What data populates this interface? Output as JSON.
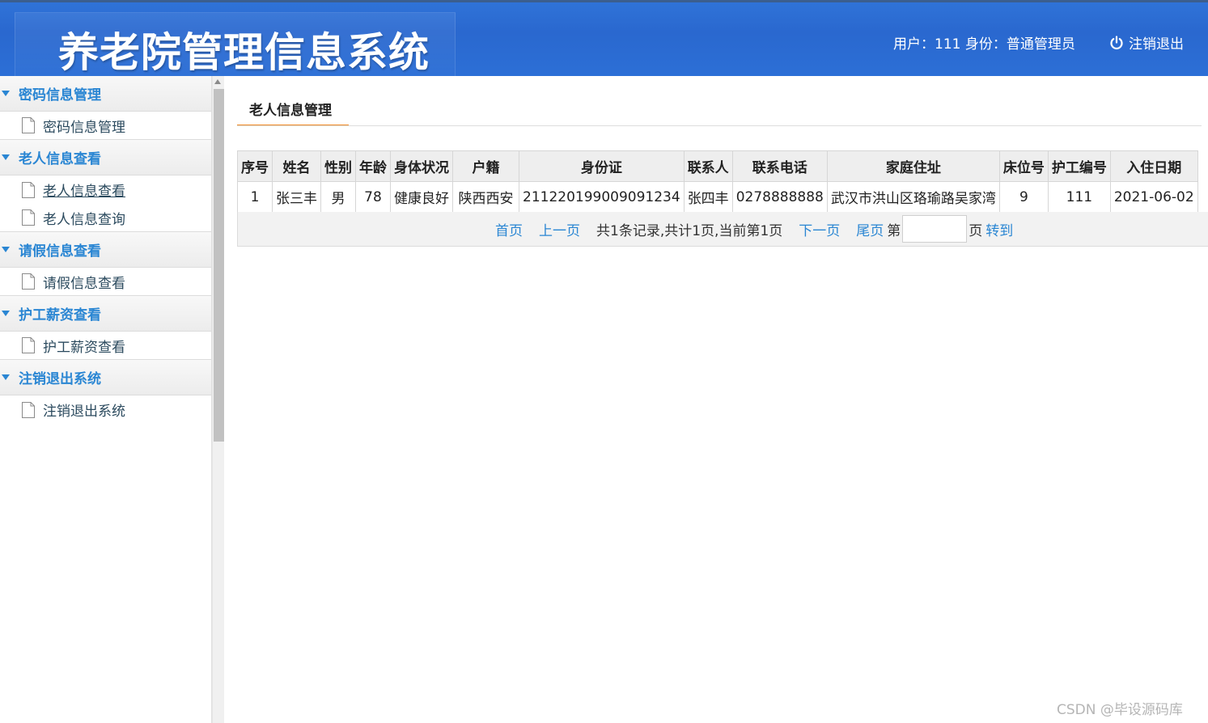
{
  "header": {
    "app_title": "养老院管理信息系统",
    "user_info": "用户：111 身份：普通管理员",
    "logout_label": "注销退出"
  },
  "sidebar": {
    "groups": [
      {
        "label": "密码信息管理",
        "items": [
          {
            "label": "密码信息管理"
          }
        ]
      },
      {
        "label": "老人信息查看",
        "items": [
          {
            "label": "老人信息查看"
          },
          {
            "label": "老人信息查询"
          }
        ]
      },
      {
        "label": "请假信息查看",
        "items": [
          {
            "label": "请假信息查看"
          }
        ]
      },
      {
        "label": "护工薪资查看",
        "items": [
          {
            "label": "护工薪资查看"
          }
        ]
      },
      {
        "label": "注销退出系统",
        "items": [
          {
            "label": "注销退出系统"
          }
        ]
      }
    ]
  },
  "main": {
    "tab_title": "老人信息管理",
    "table": {
      "columns": [
        "序号",
        "姓名",
        "性别",
        "年龄",
        "身体状况",
        "户籍",
        "身份证",
        "联系人",
        "联系电话",
        "家庭住址",
        "床位号",
        "护工编号",
        "入住日期"
      ],
      "rows": [
        [
          "1",
          "张三丰",
          "男",
          "78",
          "健康良好",
          "陕西西安",
          "211220199009091234",
          "张四丰",
          "0278888888",
          "武汉市洪山区珞瑜路吴家湾",
          "9",
          "111",
          "2021-06-02"
        ]
      ]
    },
    "pager": {
      "first": "首页",
      "prev": "上一页",
      "info": "共1条记录,共计1页,当前第1页",
      "next": "下一页",
      "last": "尾页",
      "page_prefix": "第",
      "page_suffix": "页",
      "go": "转到",
      "page_input_value": ""
    }
  },
  "watermark": "CSDN @毕设源码库",
  "colors": {
    "header_blue": "#2c6fd6",
    "link_blue": "#2a86d3",
    "tab_underline": "#f08a24"
  }
}
